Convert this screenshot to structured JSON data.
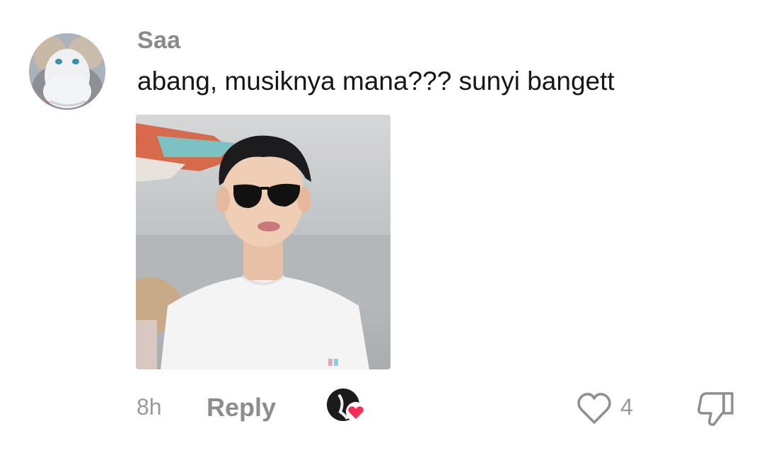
{
  "comment": {
    "username": "Saa",
    "text": "abang, musiknya mana??? sunyi bangett",
    "time_ago": "8h",
    "reply_label": "Reply",
    "like_count": "4"
  },
  "icons": {
    "like": "heart-outline-icon",
    "dislike": "thumbs-down-outline-icon",
    "creator_liked": "creator-liked-heart-badge"
  },
  "colors": {
    "username": "#8a8a8a",
    "text": "#161616",
    "meta": "#9a9a9a",
    "creator_heart": "#fe2c55"
  }
}
